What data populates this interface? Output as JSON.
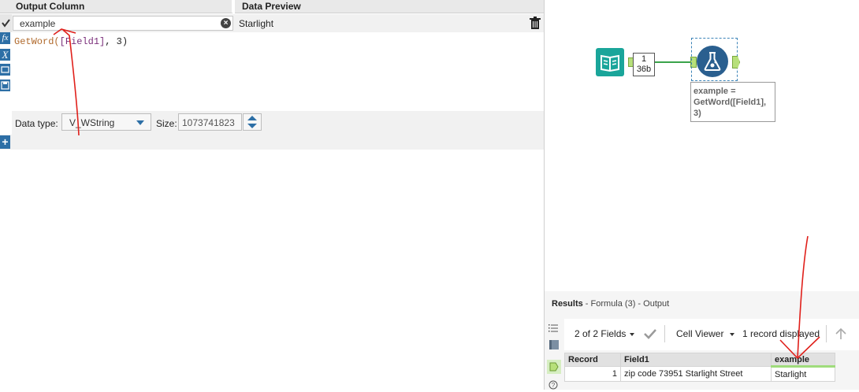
{
  "formula_panel": {
    "header_output": "Output Column",
    "header_preview": "Data Preview",
    "output_column_value": "example",
    "preview_value": "Starlight",
    "expression": {
      "fn": "GetWord(",
      "field": "[Field1]",
      "rest": ", 3)"
    },
    "data_type_label": "Data type:",
    "data_type_value": "V_WString",
    "size_label": "Size:",
    "size_value": "1073741823"
  },
  "canvas": {
    "input_record_count": "1",
    "input_size": "36b",
    "formula_annotation": "example = GetWord([Field1], 3)"
  },
  "results": {
    "title_prefix": "Results",
    "title_suffix": " - Formula (3) - Output",
    "fields_dropdown": "2 of 2 Fields",
    "viewer_dropdown": "Cell Viewer",
    "records_displayed": "1 record displayed",
    "columns": [
      "Record",
      "Field1",
      "example"
    ],
    "rows": [
      {
        "record": "1",
        "field1": "zip code 73951 Starlight Street",
        "example": "Starlight"
      }
    ]
  },
  "colors": {
    "accent_blue": "#2d6fa6",
    "input_tool_teal": "#1aa59a",
    "formula_tool_blue": "#2a5f8f",
    "connection_green": "#3aa34a",
    "new_column_green": "#9fdc7c",
    "annotation_red": "#e0201b"
  },
  "icons": [
    "check-icon",
    "clear-icon",
    "trash-icon",
    "fx-icon",
    "variable-icon",
    "folder-icon",
    "save-icon",
    "add-icon",
    "book-icon",
    "flask-icon",
    "list-icon",
    "table-icon",
    "anchor-icon",
    "help-icon",
    "checkmark-icon",
    "arrow-up-icon"
  ]
}
